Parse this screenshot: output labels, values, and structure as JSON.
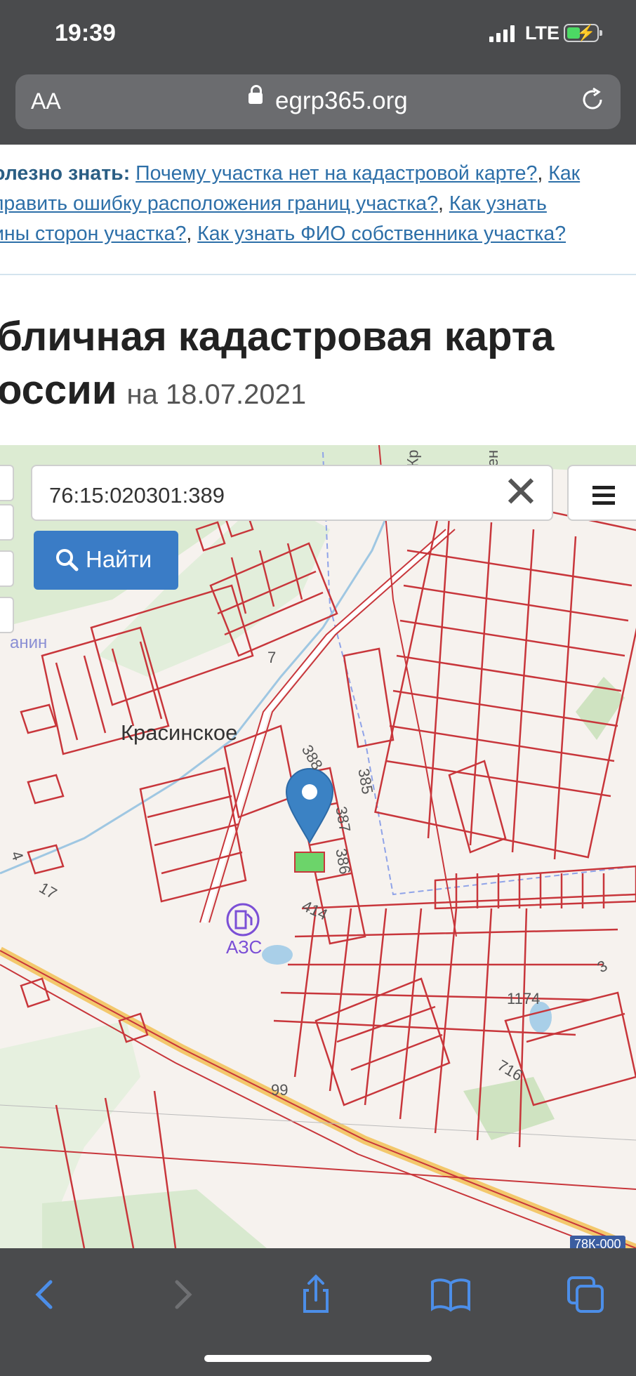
{
  "status_bar": {
    "time": "19:39",
    "network": "LTE",
    "battery_charging": true
  },
  "url_bar": {
    "text_size_label": "AA",
    "host": "egrp365.org"
  },
  "info_line": {
    "label": "олезно знать:",
    "links": [
      "Почему участка нет на кадастровой карте?",
      "Как",
      "править ошибку расположения границ участка?",
      "Как узнать",
      "ины сторон участка?",
      "Как узнать ФИО собственника участка?"
    ]
  },
  "heading": {
    "line1": "бличная кадастровая карта",
    "line2": "оссии",
    "date": "на 18.07.2021"
  },
  "map": {
    "search_value": "76:15:020301:389",
    "clear_symbol": "✕",
    "find_label": "Найти",
    "village_label": "Красинское",
    "gas_station_label": "АЗС",
    "plot_numbers": [
      "7",
      "388",
      "385",
      "387",
      "386",
      "414",
      "1174",
      "716",
      "99",
      "3",
      "17",
      "4"
    ],
    "road_badge": "78К-000",
    "partial_label": "анин",
    "top_labels": [
      "Кр",
      "ен"
    ]
  },
  "colors": {
    "chrome": "#4a4b4d",
    "link": "#2d6fa8",
    "boundary": "#c8363b",
    "button": "#3a7cc6",
    "road": "#f0b64a",
    "pin": "#3b82c4"
  }
}
